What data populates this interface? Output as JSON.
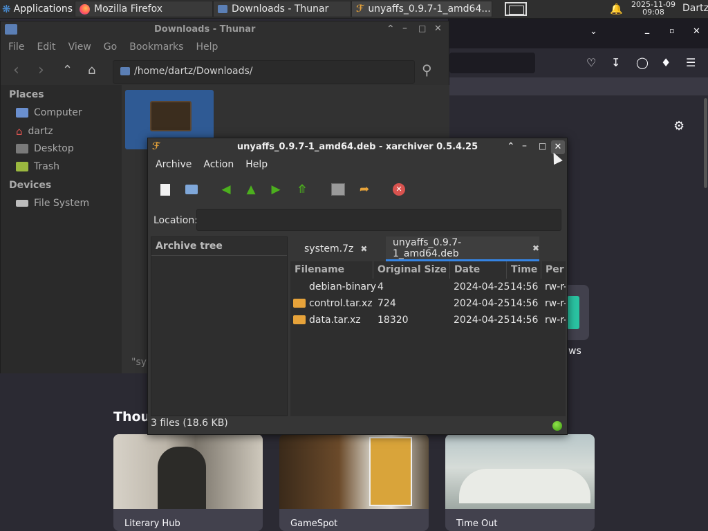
{
  "panel": {
    "applications": "Applications",
    "tasks": [
      {
        "label": "Mozilla Firefox",
        "icon": "firefox-icon"
      },
      {
        "label": "Downloads - Thunar",
        "icon": "folder-icon"
      },
      {
        "label": "unyaffs_0.9.7-1_amd64....",
        "icon": "xarchiver-icon"
      }
    ],
    "clock_date": "2025-11-09",
    "clock_time": "09:08",
    "user": "Dartz"
  },
  "firefox": {
    "shortcut_label": "ws",
    "section_heading": "Thou",
    "cards": [
      {
        "label": "Literary Hub"
      },
      {
        "label": "GameSpot"
      },
      {
        "label": "Time Out"
      }
    ]
  },
  "thunar": {
    "title": "Downloads - Thunar",
    "menu": [
      "File",
      "Edit",
      "View",
      "Go",
      "Bookmarks",
      "Help"
    ],
    "path": "/home/dartz/Downloads/",
    "places_heading": "Places",
    "places": [
      "Computer",
      "dartz",
      "Desktop",
      "Trash"
    ],
    "devices_heading": "Devices",
    "devices": [
      "File System"
    ],
    "status_fragment": "\"sy"
  },
  "xarchiver": {
    "title": "unyaffs_0.9.7-1_amd64.deb - xarchiver 0.5.4.25",
    "menu": [
      "Archive",
      "Action",
      "Help"
    ],
    "location_label": "Location:",
    "location_value": "",
    "tree_heading": "Archive tree",
    "tabs": [
      {
        "label": "system.7z",
        "active": false
      },
      {
        "label": "unyaffs_0.9.7-1_amd64.deb",
        "active": true
      }
    ],
    "columns": [
      "Filename",
      "Original Size",
      "Date",
      "Time",
      "Per"
    ],
    "rows": [
      {
        "name": "debian-binary",
        "size": "4",
        "date": "2024-04-25",
        "time": "14:56",
        "perm": "rw-r-"
      },
      {
        "name": "control.tar.xz",
        "size": "724",
        "date": "2024-04-25",
        "time": "14:56",
        "perm": "rw-r-"
      },
      {
        "name": "data.tar.xz",
        "size": "18320",
        "date": "2024-04-25",
        "time": "14:56",
        "perm": "rw-r-"
      }
    ],
    "status": "3 files  (18.6 KB)",
    "colors": {
      "accent": "#3584e4",
      "ok_led": "#4caf1e"
    }
  }
}
